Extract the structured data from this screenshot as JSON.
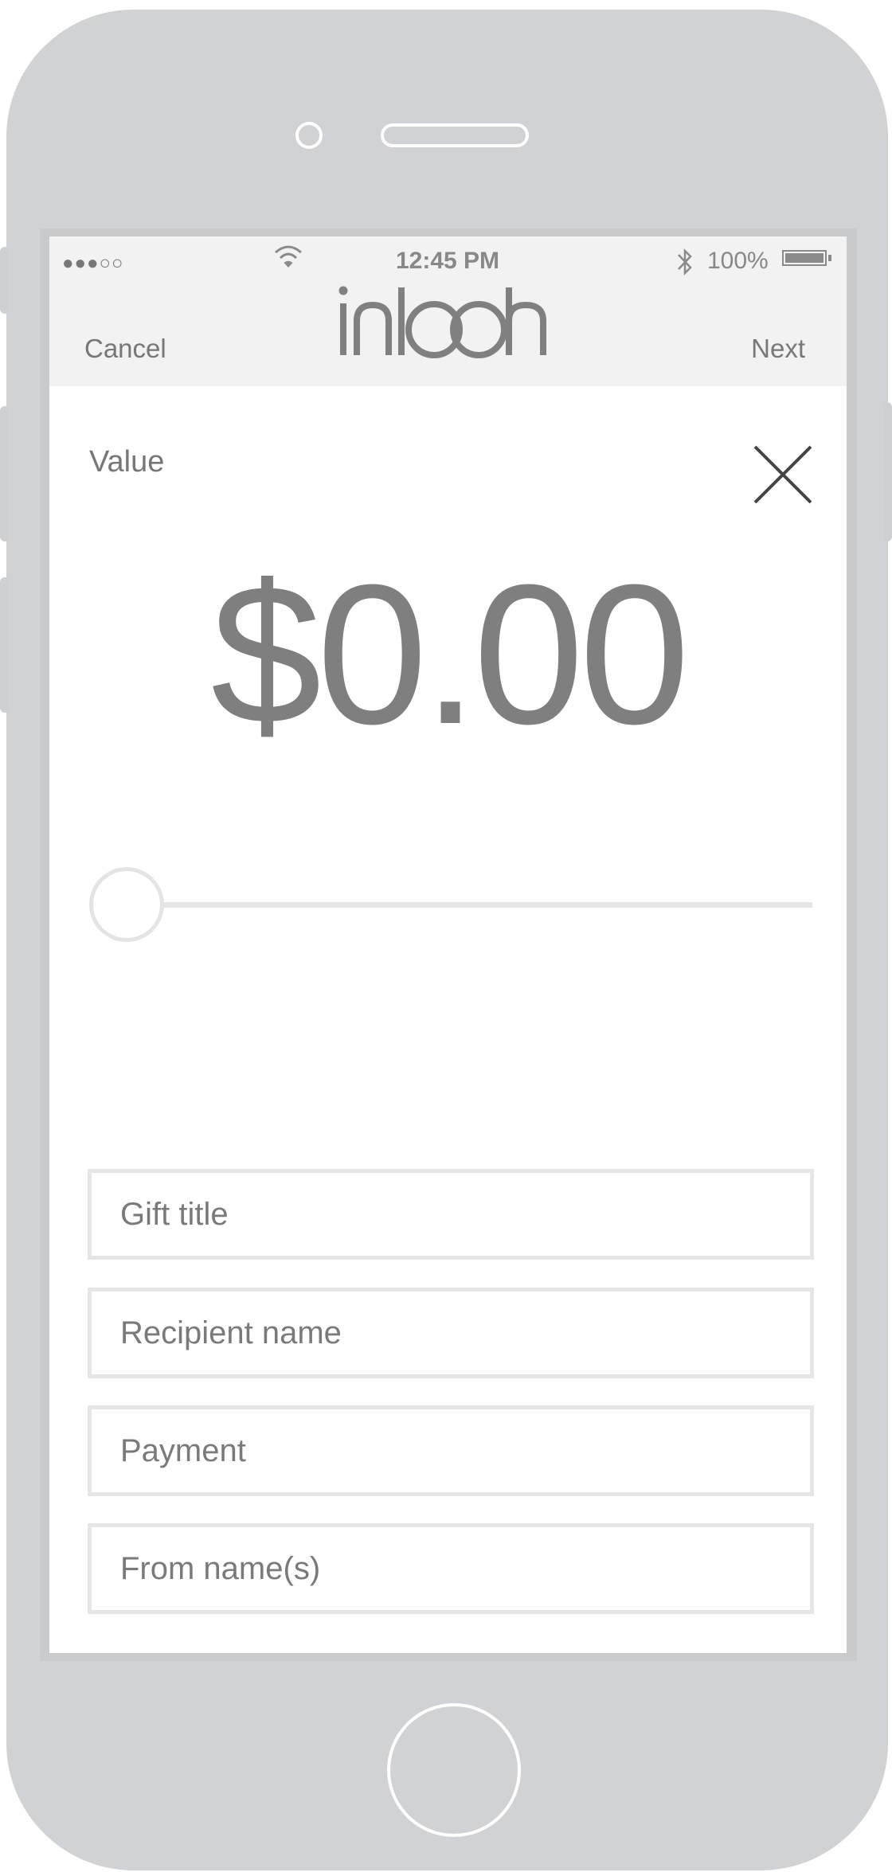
{
  "status_bar": {
    "signal": "●●●○○",
    "time": "12:45 PM",
    "battery": "100%"
  },
  "nav": {
    "cancel_label": "Cancel",
    "next_label": "Next",
    "logo_text": "inlooh"
  },
  "gift": {
    "value_label": "Value",
    "amount": "$0.00",
    "slider_value": 0
  },
  "fields": {
    "gift_title_placeholder": "Gift title",
    "recipient_placeholder": "Recipient name",
    "payment_placeholder": "Payment",
    "from_placeholder": "From name(s)"
  },
  "colors": {
    "device": "#d1d2d4",
    "nav_bg": "#f2f2f2",
    "text": "#777777"
  }
}
